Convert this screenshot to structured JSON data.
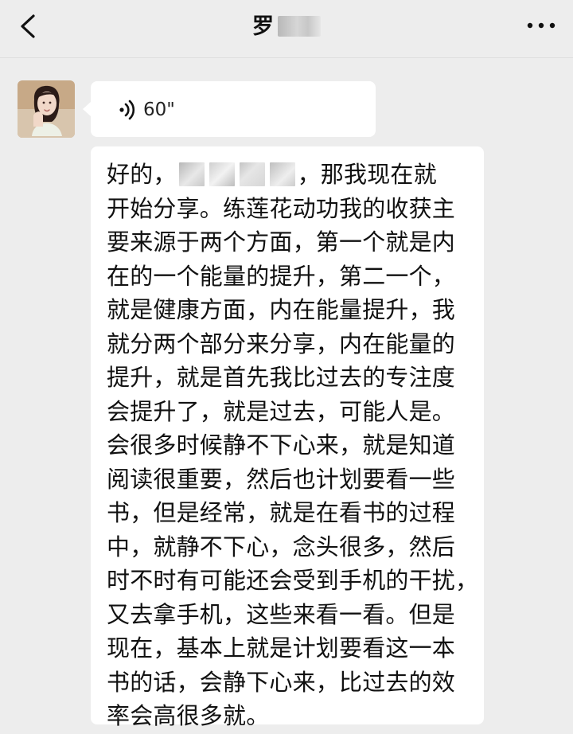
{
  "header": {
    "title_visible": "罗",
    "back_icon": "chevron-left-icon",
    "more_icon": "more-dots-icon"
  },
  "messages": [
    {
      "type": "voice",
      "duration": "60\"",
      "icon": "voice-wave-icon"
    },
    {
      "type": "text",
      "lines": [
        {
          "segments": [
            {
              "text": "好的，"
            },
            {
              "redacted": true
            },
            {
              "redacted": true
            },
            {
              "redacted": true
            },
            {
              "redacted": true
            },
            {
              "text": "，那我现在就"
            }
          ]
        },
        "开始分享。练莲花动功我的收获主",
        "要来源于两个方面，第一个就是内",
        "在的一个能量的提升，第二一个，",
        "就是健康方面，内在能量提升，我",
        "就分两个部分来分享，内在能量的",
        "提升，就是首先我比过去的专注度",
        "会提升了，就是过去，可能人是。",
        "会很多时候静不下心来，就是知道",
        "阅读很重要，然后也计划要看一些",
        "书，但是经常，就是在看书的过程",
        "中，就静不下心，念头很多，然后",
        "时不时有可能还会受到手机的干扰，",
        "又去拿手机，这些来看一看。但是",
        "现在，基本上就是计划要看这一本",
        "书的话，会静下心来，比过去的效",
        "率会高很多就。"
      ]
    }
  ]
}
